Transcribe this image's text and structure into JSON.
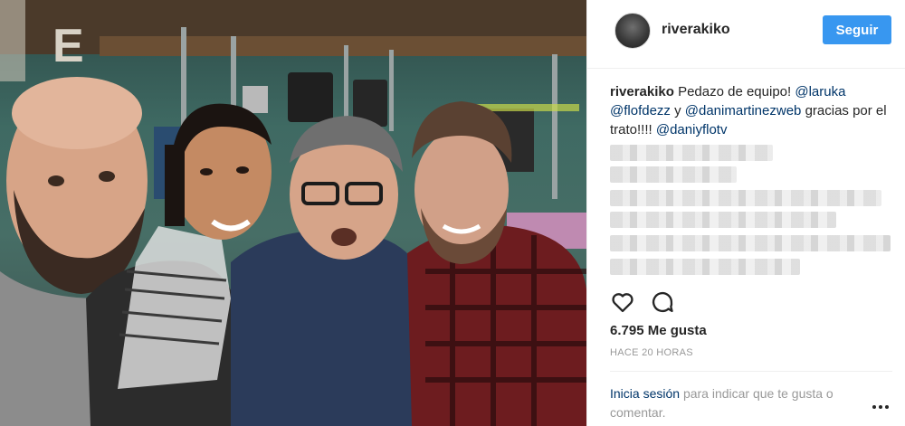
{
  "post": {
    "username": "riverakiko",
    "follow_label": "Seguir",
    "caption": {
      "username": "riverakiko",
      "text_1": "Pedazo de equipo!",
      "mention_1": "@laruka",
      "mention_2": "@flofdezz",
      "connector": "y",
      "mention_3": "@danimartinezweb",
      "text_2": "gracias por el trato!!!!",
      "mention_4": "@daniyflotv"
    },
    "likes": "6.795 Me gusta",
    "time": "HACE 20 HORAS",
    "login": {
      "link": "Inicia sesión",
      "text": "para indicar que te gusta o comentar."
    }
  },
  "icons": {
    "like": "heart-icon",
    "comment": "comment-icon",
    "more": "more-options-icon"
  },
  "colors": {
    "follow_button": "#3897f0",
    "mention": "#003569",
    "muted": "#999999"
  }
}
